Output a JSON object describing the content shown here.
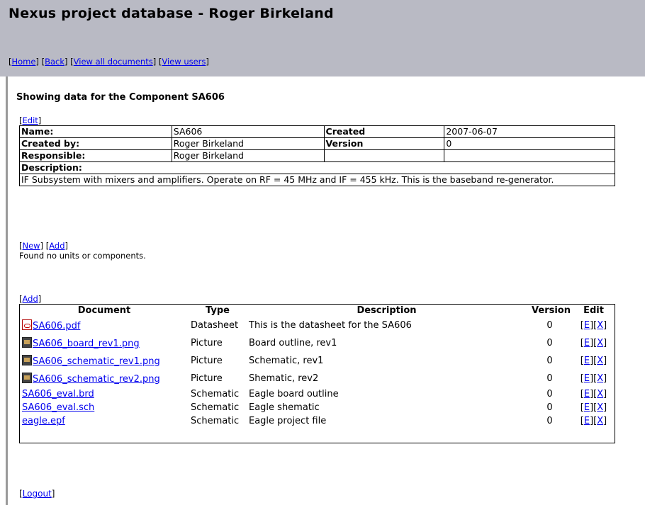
{
  "site": {
    "title": "Nexus project database - Roger Birkeland"
  },
  "nav": {
    "home": "Home",
    "back": "Back",
    "view_all_documents": "View all documents",
    "view_users": "View users"
  },
  "component": {
    "heading": "Showing data for the Component SA606",
    "edit_label": "Edit",
    "labels": {
      "name": "Name:",
      "created_by": "Created by:",
      "responsible": "Responsible:",
      "description": "Description:",
      "created": "Created",
      "version": "Version"
    },
    "name": "SA606",
    "created": "2007-06-07",
    "created_by": "Roger Birkeland",
    "version": "0",
    "responsible": "Roger Birkeland",
    "description": "IF Subsystem with mixers and amplifiers. Operate on RF = 45 MHz and IF = 455 kHz. This is the baseband re-generator."
  },
  "units": {
    "new_label": "New",
    "add_label": "Add",
    "empty_message": "Found no units or components."
  },
  "documents": {
    "add_label": "Add",
    "columns": {
      "document": "Document",
      "type": "Type",
      "description": "Description",
      "version": "Version",
      "edit": "Edit"
    },
    "edit_label": "E",
    "delete_label": "X",
    "rows": [
      {
        "name": "SA606.pdf",
        "icon": "pdf-file-icon",
        "type": "Datasheet",
        "description": "This is the datasheet for the SA606",
        "version": "0"
      },
      {
        "name": "SA606_board_rev1.png",
        "icon": "image-file-icon",
        "type": "Picture",
        "description": "Board outline, rev1",
        "version": "0"
      },
      {
        "name": "SA606_schematic_rev1.png",
        "icon": "image-file-icon",
        "type": "Picture",
        "description": "Schematic, rev1",
        "version": "0"
      },
      {
        "name": "SA606_schematic_rev2.png",
        "icon": "image-file-icon",
        "type": "Picture",
        "description": "Shematic, rev2",
        "version": "0"
      },
      {
        "name": "SA606_eval.brd",
        "icon": "",
        "type": "Schematic",
        "description": "Eagle board outline",
        "version": "0"
      },
      {
        "name": "SA606_eval.sch",
        "icon": "",
        "type": "Schematic",
        "description": "Eagle shematic",
        "version": "0"
      },
      {
        "name": "eagle.epf",
        "icon": "",
        "type": "Schematic",
        "description": "Eagle project file",
        "version": "0"
      }
    ]
  },
  "footer": {
    "logout_label": "Logout"
  }
}
